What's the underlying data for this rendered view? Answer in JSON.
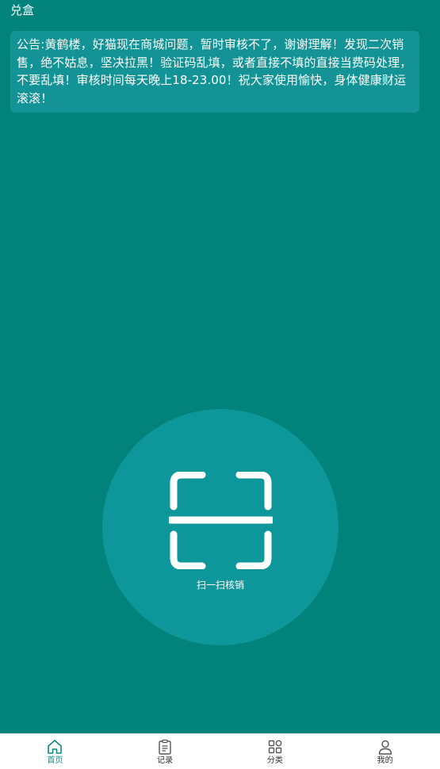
{
  "header": {
    "title": "兑盒"
  },
  "notice": {
    "text": "公告:黄鹤楼，好猫现在商城问题，暂时审核不了，谢谢理解！发现二次销售，绝不姑息，坚决拉黑！验证码乱填，或者直接不填的直接当费码处理，不要乱填！审核时间每天晚上18-23.00！祝大家使用愉快，身体健康财运滚滚！"
  },
  "scan": {
    "label": "扫一扫核销",
    "icon": "scan-icon"
  },
  "tabbar": {
    "active_color": "#0a8a84",
    "items": [
      {
        "label": "首页",
        "icon": "home-icon",
        "active": true
      },
      {
        "label": "记录",
        "icon": "clipboard-icon",
        "active": false
      },
      {
        "label": "分类",
        "icon": "category-grid-icon",
        "active": false
      },
      {
        "label": "我的",
        "icon": "user-icon",
        "active": false
      }
    ]
  },
  "colors": {
    "background": "#01827b",
    "notice_bg": "#139396",
    "circle_bg": "#0d979b"
  }
}
